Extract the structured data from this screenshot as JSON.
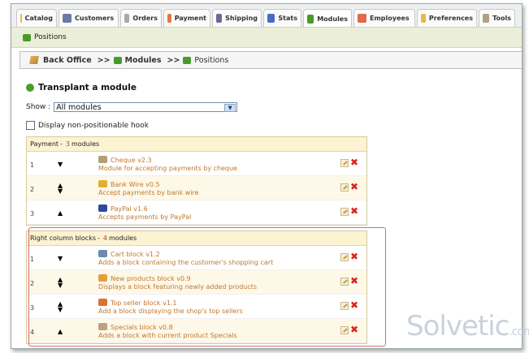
{
  "tabs": [
    {
      "label": "Catalog",
      "icon": "folder-icon",
      "color": "#e8b84a"
    },
    {
      "label": "Customers",
      "icon": "customers-icon",
      "color": "#6a7aa8"
    },
    {
      "label": "Orders",
      "icon": "orders-icon",
      "color": "#a8a8a8"
    },
    {
      "label": "Payment",
      "icon": "payment-icon",
      "color": "#e07a3a"
    },
    {
      "label": "Shipping",
      "icon": "shipping-icon",
      "color": "#6a6a9a"
    },
    {
      "label": "Stats",
      "icon": "stats-icon",
      "color": "#4a6ac8"
    },
    {
      "label": "Modules",
      "icon": "modules-icon",
      "color": "#4a9a2a"
    },
    {
      "label": "Employees",
      "icon": "employees-icon",
      "color": "#e06a4a"
    },
    {
      "label": "Preferences",
      "icon": "preferences-icon",
      "color": "#e8b84a"
    },
    {
      "label": "Tools",
      "icon": "tools-icon",
      "color": "#b0a080"
    }
  ],
  "active_tab": "Modules",
  "subtab": {
    "label": "Positions",
    "icon": "positions-icon"
  },
  "breadcrumb": {
    "root": "Back Office",
    "sep1": ">>",
    "mid": "Modules",
    "sep2": ">>",
    "current": "Positions"
  },
  "page_title": "Transplant a module",
  "show": {
    "label": "Show :",
    "value": "All modules"
  },
  "checkbox": {
    "label": "Display non-positionable hook",
    "checked": false
  },
  "payment": {
    "title": "Payment",
    "sep": "-",
    "count": "3",
    "count_suffix": "modules",
    "rows": [
      {
        "pos": "1",
        "arrows": "down",
        "name": "Cheque v2.3",
        "desc": "Module for accepting payments by cheque",
        "icon_color": "#b0a070"
      },
      {
        "pos": "2",
        "arrows": "both",
        "name": "Bank Wire v0.5",
        "desc": "Accept payments by bank wire",
        "icon_color": "#e0b030"
      },
      {
        "pos": "3",
        "arrows": "up",
        "name": "PayPal v1.6",
        "desc": "Accepts payments by PayPal",
        "icon_color": "#2a4a9a"
      }
    ]
  },
  "right_blocks": {
    "title": "Right column blocks",
    "sep": "-",
    "count": "4",
    "count_suffix": "modules",
    "rows": [
      {
        "pos": "1",
        "arrows": "down",
        "name": "Cart block v1.2",
        "desc": "Adds a block containing the customer's shopping cart",
        "icon_color": "#6a8ab0"
      },
      {
        "pos": "2",
        "arrows": "both",
        "name": "New products block v0.9",
        "desc": "Displays a block featuring newly added products",
        "icon_color": "#e0a040"
      },
      {
        "pos": "3",
        "arrows": "both",
        "name": "Top seller block v1.1",
        "desc": "Add a block displaying the shop's top sellers",
        "icon_color": "#e07030"
      },
      {
        "pos": "4",
        "arrows": "up",
        "name": "Specials block v0.8",
        "desc": "Adds a block with current product Specials",
        "icon_color": "#c0a080"
      }
    ]
  },
  "watermark": {
    "brand": "Solvetic",
    "domain": ".com"
  }
}
